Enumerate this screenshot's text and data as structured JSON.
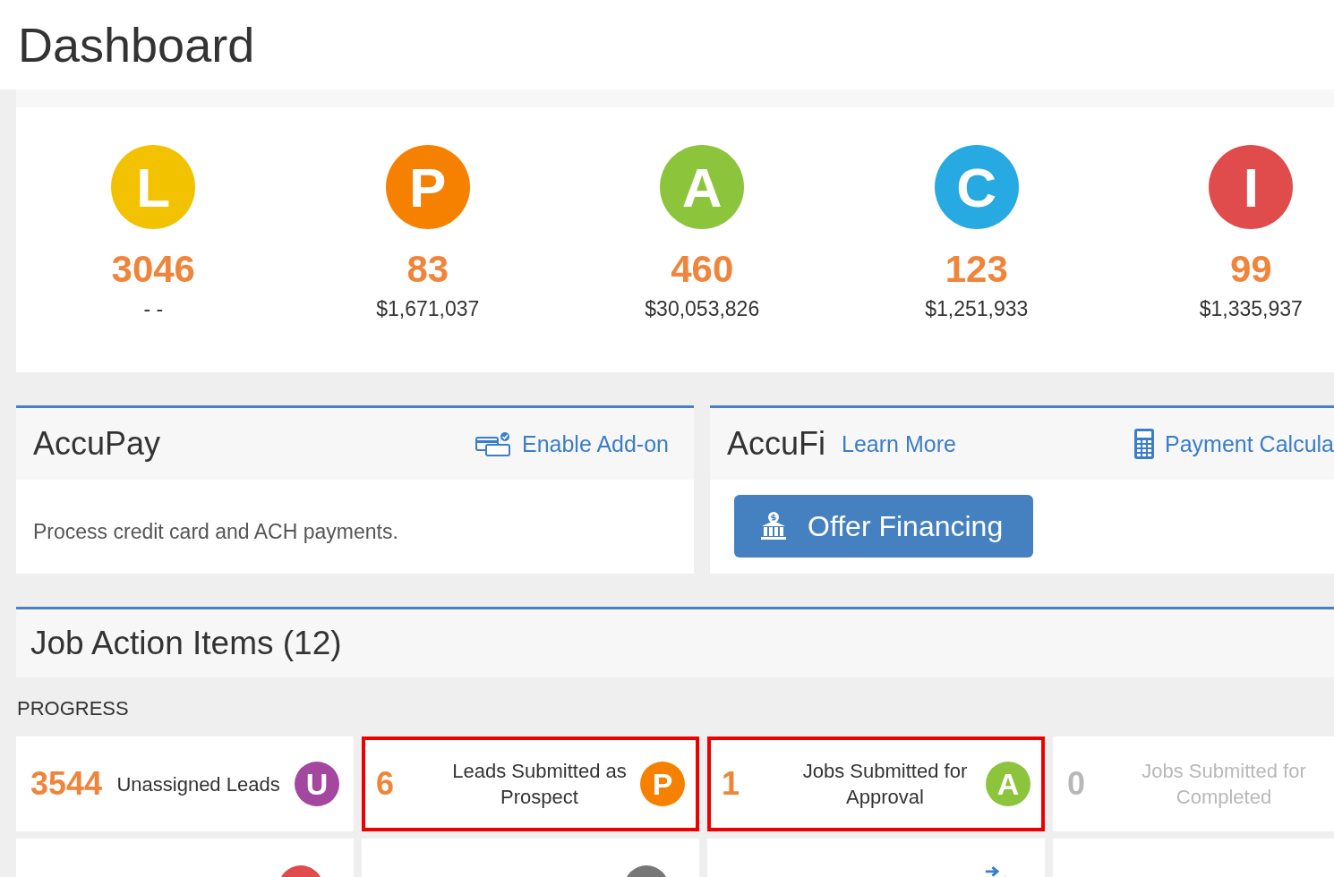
{
  "page": {
    "title": "Dashboard"
  },
  "stats": [
    {
      "letter": "L",
      "color": "#f2c200",
      "count": "3046",
      "amount": "- -"
    },
    {
      "letter": "P",
      "color": "#f68100",
      "count": "83",
      "amount": "$1,671,037"
    },
    {
      "letter": "A",
      "color": "#8cc43c",
      "count": "460",
      "amount": "$30,053,826"
    },
    {
      "letter": "C",
      "color": "#27a9e1",
      "count": "123",
      "amount": "$1,251,933"
    },
    {
      "letter": "I",
      "color": "#e04c4c",
      "count": "99",
      "amount": "$1,335,937"
    }
  ],
  "accupay": {
    "title": "AccuPay",
    "link": "Enable Add-on",
    "description": "Process credit card and ACH payments."
  },
  "accufi": {
    "title": "AccuFi",
    "learn_more": "Learn More",
    "calculator_link": "Payment Calcula",
    "button": "Offer Financing"
  },
  "job_action_items": {
    "title": "Job Action Items (12)",
    "section": "PROGRESS",
    "cards": [
      {
        "count": "3544",
        "label": "Unassigned Leads",
        "highlighted": false,
        "disabled": false,
        "badge": {
          "kind": "letter",
          "letter": "U",
          "color": "#a3489e"
        }
      },
      {
        "count": "6",
        "label": "Leads Submitted as Prospect",
        "highlighted": true,
        "disabled": false,
        "badge": {
          "kind": "letter",
          "letter": "P",
          "color": "#f68100"
        }
      },
      {
        "count": "1",
        "label": "Jobs Submitted for Approval",
        "highlighted": true,
        "disabled": false,
        "badge": {
          "kind": "letter",
          "letter": "A",
          "color": "#8cc43c"
        }
      },
      {
        "count": "0",
        "label": "Jobs Submitted for Completed",
        "highlighted": false,
        "disabled": true
      },
      {
        "highlighted": false,
        "badge": {
          "kind": "dot",
          "color": "#e04c4c"
        }
      },
      {
        "highlighted": false,
        "badge": {
          "kind": "dot",
          "color": "#777777"
        }
      },
      {
        "highlighted": false,
        "badge": {
          "kind": "icon",
          "color": "#3a7dc9"
        }
      },
      {
        "highlighted": false
      }
    ]
  }
}
